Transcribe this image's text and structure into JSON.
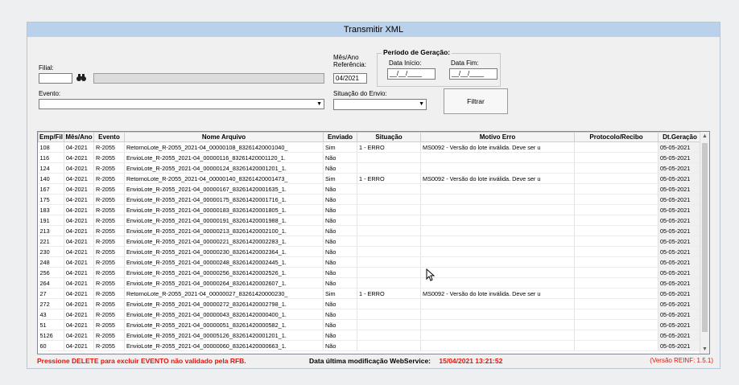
{
  "window": {
    "title": "Transmitir XML"
  },
  "filial": {
    "label": "Filial:",
    "value": "",
    "search_icon": "binoculars-icon"
  },
  "evento": {
    "label": "Evento:",
    "value": ""
  },
  "mes_ano": {
    "label_line1": "Mês/Ano",
    "label_line2": "Referência:",
    "value": "04/2021"
  },
  "periodo": {
    "title": "Período de Geração:",
    "inicio_label": "Data Início:",
    "inicio_value": "__/__/____",
    "fim_label": "Data Fim:",
    "fim_value": "__/__/____"
  },
  "situacao_envio": {
    "label": "Situação do Envio:",
    "value": ""
  },
  "filter_button": {
    "label": "Filtrar"
  },
  "table": {
    "columns": [
      "Emp/Fil",
      "Mês/Ano",
      "Evento",
      "Nome Arquivo",
      "Enviado",
      "Situação",
      "Motivo Erro",
      "Protocolo/Recibo",
      "Dt.Geração"
    ],
    "rows": [
      [
        "108",
        "04-2021",
        "R-2055",
        "RetornoLote_R-2055_2021-04_00000108_83261420001040_",
        "Sim",
        "1 - ERRO",
        "MS0092 - Versão do lote inválida. Deve ser u",
        "",
        "05-05-2021"
      ],
      [
        "116",
        "04-2021",
        "R-2055",
        "EnvioLote_R-2055_2021-04_00000116_83261420001120_1.",
        "Não",
        "",
        "",
        "",
        "05-05-2021"
      ],
      [
        "124",
        "04-2021",
        "R-2055",
        "EnvioLote_R-2055_2021-04_00000124_83261420001201_1.",
        "Não",
        "",
        "",
        "",
        "05-05-2021"
      ],
      [
        "140",
        "04-2021",
        "R-2055",
        "RetornoLote_R-2055_2021-04_00000140_83261420001473_",
        "Sim",
        "1 - ERRO",
        "MS0092 - Versão do lote inválida. Deve ser u",
        "",
        "05-05-2021"
      ],
      [
        "167",
        "04-2021",
        "R-2055",
        "EnvioLote_R-2055_2021-04_00000167_83261420001635_1.",
        "Não",
        "",
        "",
        "",
        "05-05-2021"
      ],
      [
        "175",
        "04-2021",
        "R-2055",
        "EnvioLote_R-2055_2021-04_00000175_83261420001716_1.",
        "Não",
        "",
        "",
        "",
        "05-05-2021"
      ],
      [
        "183",
        "04-2021",
        "R-2055",
        "EnvioLote_R-2055_2021-04_00000183_83261420001805_1.",
        "Não",
        "",
        "",
        "",
        "05-05-2021"
      ],
      [
        "191",
        "04-2021",
        "R-2055",
        "EnvioLote_R-2055_2021-04_00000191_83261420001988_1.",
        "Não",
        "",
        "",
        "",
        "05-05-2021"
      ],
      [
        "213",
        "04-2021",
        "R-2055",
        "EnvioLote_R-2055_2021-04_00000213_83261420002100_1.",
        "Não",
        "",
        "",
        "",
        "05-05-2021"
      ],
      [
        "221",
        "04-2021",
        "R-2055",
        "EnvioLote_R-2055_2021-04_00000221_83261420002283_1.",
        "Não",
        "",
        "",
        "",
        "05-05-2021"
      ],
      [
        "230",
        "04-2021",
        "R-2055",
        "EnvioLote_R-2055_2021-04_00000230_83261420002364_1.",
        "Não",
        "",
        "",
        "",
        "05-05-2021"
      ],
      [
        "248",
        "04-2021",
        "R-2055",
        "EnvioLote_R-2055_2021-04_00000248_83261420002445_1.",
        "Não",
        "",
        "",
        "",
        "05-05-2021"
      ],
      [
        "256",
        "04-2021",
        "R-2055",
        "EnvioLote_R-2055_2021-04_00000256_83261420002526_1.",
        "Não",
        "",
        "",
        "",
        "05-05-2021"
      ],
      [
        "264",
        "04-2021",
        "R-2055",
        "EnvioLote_R-2055_2021-04_00000264_83261420002607_1.",
        "Não",
        "",
        "",
        "",
        "05-05-2021"
      ],
      [
        "27",
        "04-2021",
        "R-2055",
        "RetornoLote_R-2055_2021-04_00000027_83261420000230_",
        "Sim",
        "1 - ERRO",
        "MS0092 - Versão do lote inválida. Deve ser u",
        "",
        "05-05-2021"
      ],
      [
        "272",
        "04-2021",
        "R-2055",
        "EnvioLote_R-2055_2021-04_00000272_83261420002798_1.",
        "Não",
        "",
        "",
        "",
        "05-05-2021"
      ],
      [
        "43",
        "04-2021",
        "R-2055",
        "EnvioLote_R-2055_2021-04_00000043_83261420000400_1.",
        "Não",
        "",
        "",
        "",
        "05-05-2021"
      ],
      [
        "51",
        "04-2021",
        "R-2055",
        "EnvioLote_R-2055_2021-04_00000051_83261420000582_1.",
        "Não",
        "",
        "",
        "",
        "05-05-2021"
      ],
      [
        "5126",
        "04-2021",
        "R-2055",
        "EnvioLote_R-2055_2021-04_00005126_83261420001201_1.",
        "Não",
        "",
        "",
        "",
        "05-05-2021"
      ],
      [
        "60",
        "04-2021",
        "R-2055",
        "EnvioLote_R-2055_2021-04_00000060_83261420000663_1.",
        "Não",
        "",
        "",
        "",
        "05-05-2021"
      ]
    ]
  },
  "footer": {
    "delete_hint": "Pressione DELETE para excluir EVENTO não validado pela RFB.",
    "ws_label": "Data última modificação WebService:",
    "ws_value": "15/04/2021 13:21:52",
    "version": "(Versão REINF: 1.5.1)"
  },
  "colors": {
    "titlebar": "#b9d1ea",
    "alert_red": "#e0140c"
  }
}
